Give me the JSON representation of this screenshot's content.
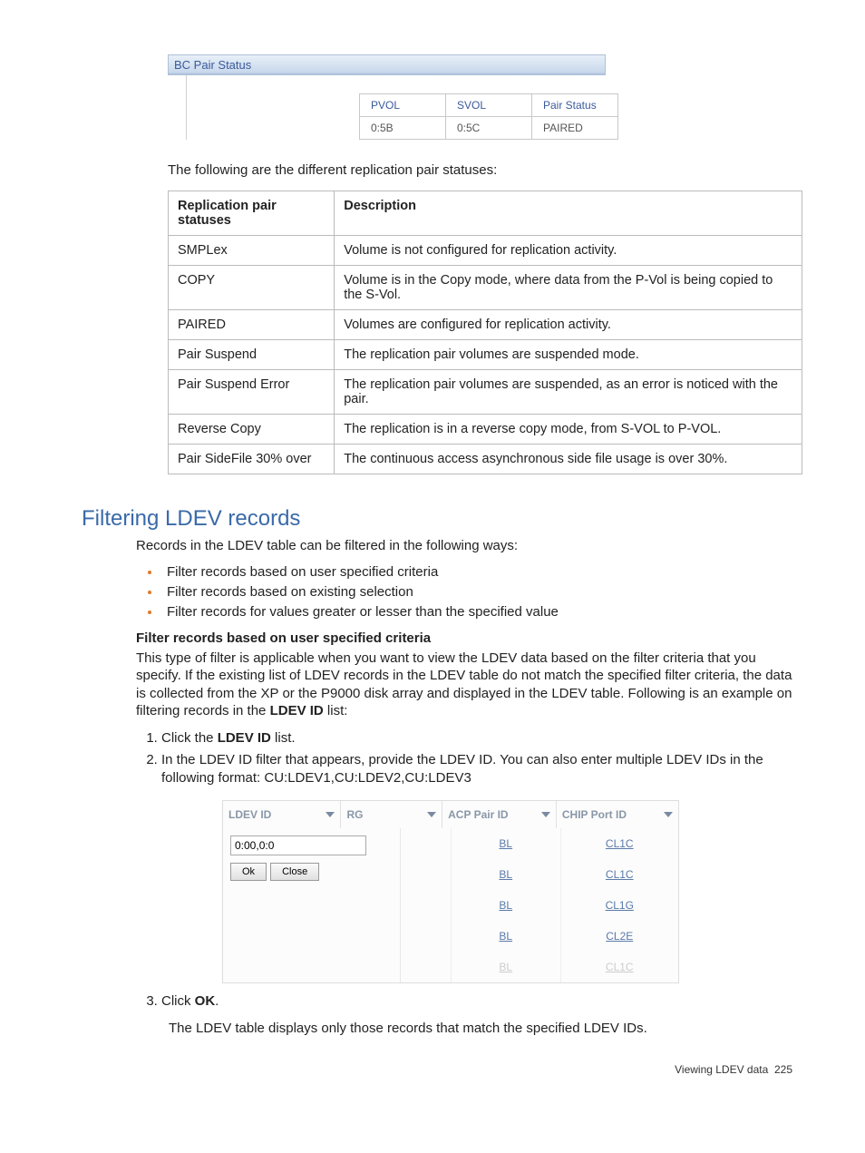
{
  "bc": {
    "title": "BC Pair Status",
    "headers": [
      "PVOL",
      "SVOL",
      "Pair Status"
    ],
    "row": [
      "0:5B",
      "0:5C",
      "PAIRED"
    ]
  },
  "intro": "The following are the different replication pair statuses:",
  "statusTable": {
    "h1": "Replication pair statuses",
    "h2": "Description",
    "rows": [
      {
        "s": "SMPLex",
        "d": "Volume is not configured for replication activity."
      },
      {
        "s": "COPY",
        "d": "Volume is in the Copy mode, where data from the P-Vol is being copied to the S-Vol."
      },
      {
        "s": "PAIRED",
        "d": "Volumes are configured for replication activity."
      },
      {
        "s": "Pair Suspend",
        "d": "The replication pair volumes are suspended mode."
      },
      {
        "s": "Pair Suspend Error",
        "d": "The replication pair volumes are suspended, as an error is noticed with the pair."
      },
      {
        "s": "Reverse Copy",
        "d": "The replication is in a reverse copy mode, from S-VOL to P-VOL."
      },
      {
        "s": "Pair SideFile 30% over",
        "d": "The continuous access asynchronous side file usage is over 30%."
      }
    ]
  },
  "sectionTitle": "Filtering LDEV records",
  "filterIntro": "Records in the LDEV table can be filtered in the following ways:",
  "bullets": [
    "Filter records based on user specified criteria",
    "Filter records based on existing selection",
    "Filter records for values greater or lesser than the specified value"
  ],
  "subhead": "Filter records based on user specified criteria",
  "para1a": "This type of filter is applicable when you want to view the LDEV data based on the filter criteria that you specify. If the existing list of LDEV records in the LDEV table do not match the specified filter criteria, the data is collected from the XP or the P9000 disk array and displayed in the LDEV table. Following is an example on filtering records in the ",
  "para1b": "LDEV ID",
  "para1c": " list:",
  "step1a": "Click the ",
  "step1b": "LDEV ID",
  "step1c": " list.",
  "step2": "In the LDEV ID filter that appears, provide the LDEV ID. You can also enter multiple LDEV IDs in the following format: CU:LDEV1,CU:LDEV2,CU:LDEV3",
  "grid": {
    "cols": [
      "LDEV ID",
      "RG",
      "ACP Pair ID",
      "CHIP Port ID"
    ],
    "input": "0:00,0:0",
    "ok": "Ok",
    "close": "Close",
    "acp": [
      "BL",
      "BL",
      "BL",
      "BL",
      "BL"
    ],
    "chip": [
      "CL1C",
      "CL1C",
      "CL1G",
      "CL2E",
      "CL1C"
    ]
  },
  "step3a": "Click ",
  "step3b": "OK",
  "step3c": ".",
  "step3sub": "The LDEV table displays only those records that match the specified LDEV IDs.",
  "footer": {
    "label": "Viewing LDEV data",
    "page": "225"
  }
}
